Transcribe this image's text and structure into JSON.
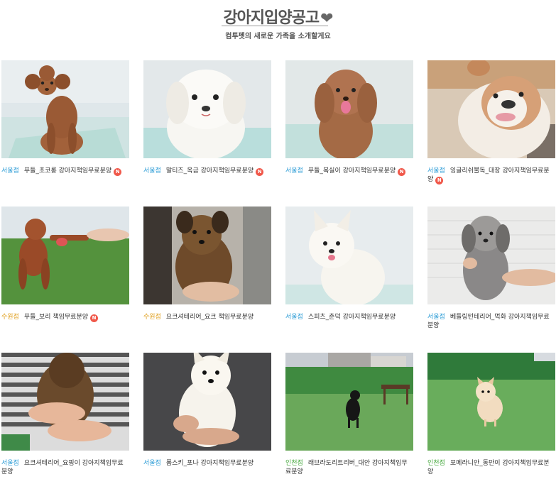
{
  "header": {
    "title": "강아지입양공고",
    "heart_icon": "heart-icon",
    "subtitle": "컴투펫의 새로운 가족을 소개할게요"
  },
  "colors": {
    "seoul": "#2a9bd6",
    "suwon": "#e0a020",
    "incheon": "#46a83e",
    "new_badge": "#f0584a"
  },
  "listings": [
    {
      "branch": "서울점",
      "title": "푸들_초코롱 강아지책임무료분양",
      "new": "N"
    },
    {
      "branch": "서울점",
      "title": "말티즈_옥금 강아지책임무료분양",
      "new": "N"
    },
    {
      "branch": "서울점",
      "title": "푸들_복실이 강아지책임무료분양",
      "new": "N"
    },
    {
      "branch": "서울점",
      "title": "잉글리쉬불독_대장 강아지책임무료분양",
      "new": "N"
    },
    {
      "branch": "수원점",
      "title": "푸들_보리 책임무료분양",
      "new": "N"
    },
    {
      "branch": "수원점",
      "title": "요크셔테리어_요크 책임무료분양",
      "new": ""
    },
    {
      "branch": "서울점",
      "title": "스피츠_춘덕 강아지책임무료분양",
      "new": ""
    },
    {
      "branch": "서울점",
      "title": "베들링턴테리어_먹화 강아지책임무료분양",
      "new": ""
    },
    {
      "branch": "서울점",
      "title": "요크셔테리어_요핑이 강아지책임무료분양",
      "new": ""
    },
    {
      "branch": "서울점",
      "title": "폼스키_포나 강아지책임무료분양",
      "new": ""
    },
    {
      "branch": "인천점",
      "title": "래브라도리트리버_대안 강아지책임무료분양",
      "new": ""
    },
    {
      "branch": "인천점",
      "title": "포메라니안_동만이 강아지책임무료분양",
      "new": ""
    }
  ]
}
